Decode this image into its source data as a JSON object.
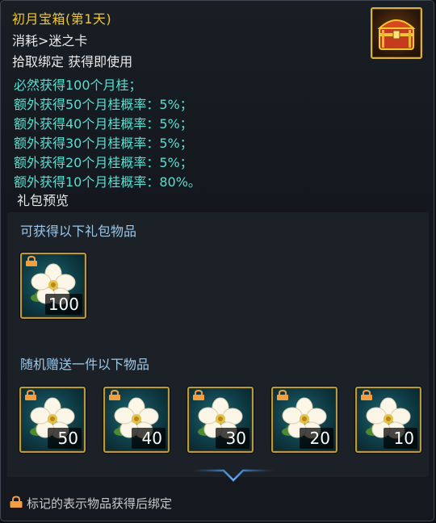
{
  "tooltip": {
    "title": "初月宝箱(第1天)",
    "consume": "消耗>迷之卡",
    "bind_info": "拾取绑定 获得即使用",
    "effects": [
      "必然获得100个月桂；",
      "额外获得50个月桂概率：5%；",
      "额外获得40个月桂概率：5%；",
      "额外获得30个月桂概率：5%；",
      "额外获得20个月桂概率：5%；",
      "额外获得10个月桂概率：80%。"
    ],
    "preview_label": "礼包预览"
  },
  "icon": "treasure-chest-icon",
  "colors": {
    "title": "#f0c832",
    "effect": "#56e0d2",
    "section": "#9cc8e9",
    "slot_border": "#b99b3d"
  },
  "guaranteed": {
    "label": "可获得以下礼包物品",
    "items": [
      {
        "icon": "laurel-flower-icon",
        "qty": "100",
        "bound": true
      }
    ]
  },
  "random": {
    "label": "随机赠送一件以下物品",
    "items": [
      {
        "icon": "laurel-flower-icon",
        "qty": "50",
        "bound": true
      },
      {
        "icon": "laurel-flower-icon",
        "qty": "40",
        "bound": true
      },
      {
        "icon": "laurel-flower-icon",
        "qty": "30",
        "bound": true
      },
      {
        "icon": "laurel-flower-icon",
        "qty": "20",
        "bound": true
      },
      {
        "icon": "laurel-flower-icon",
        "qty": "10",
        "bound": true
      }
    ]
  },
  "footer": {
    "note": "标记的表示物品获得后绑定"
  }
}
